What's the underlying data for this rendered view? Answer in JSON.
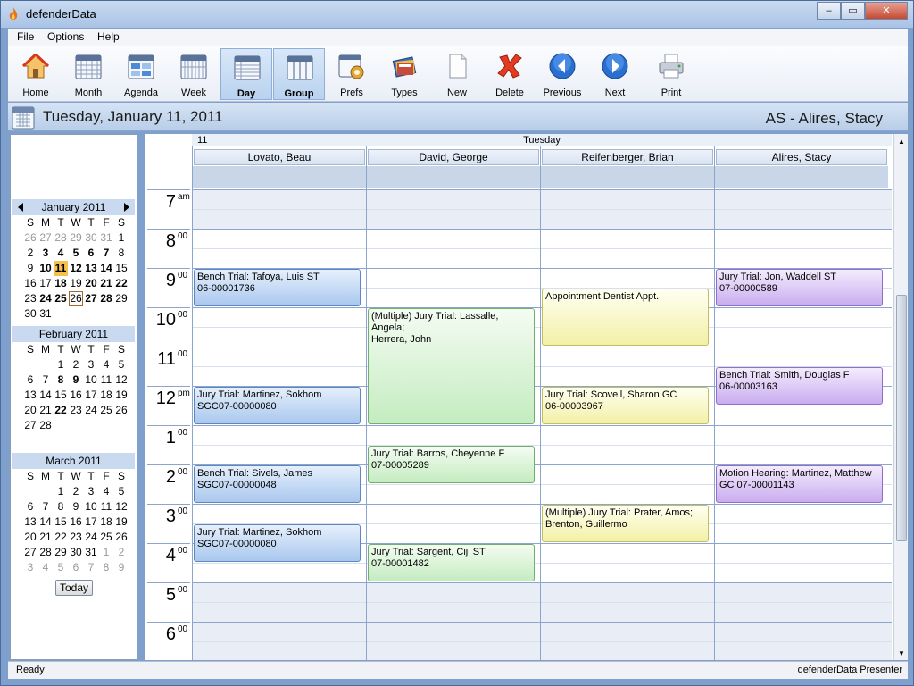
{
  "window": {
    "title": "defenderData",
    "min": "–",
    "max": "▭",
    "close": "✕"
  },
  "menu": [
    {
      "label": "File"
    },
    {
      "label": "Options"
    },
    {
      "label": "Help"
    }
  ],
  "toolbar": [
    {
      "label": "Home",
      "icon": "home-icon"
    },
    {
      "label": "Month",
      "icon": "month-calendar-icon"
    },
    {
      "label": "Agenda",
      "icon": "agenda-icon"
    },
    {
      "label": "Week",
      "icon": "week-calendar-icon"
    },
    {
      "label": "Day",
      "icon": "day-calendar-icon",
      "active": true
    },
    {
      "label": "Group",
      "icon": "group-calendar-icon",
      "active": true
    },
    {
      "label": "Prefs",
      "icon": "prefs-gear-icon"
    },
    {
      "label": "Types",
      "icon": "types-book-icon"
    },
    {
      "label": "New",
      "icon": "new-document-icon"
    },
    {
      "label": "Delete",
      "icon": "delete-x-icon"
    },
    {
      "label": "Previous",
      "icon": "previous-arrow-icon"
    },
    {
      "label": "Next",
      "icon": "next-arrow-icon"
    },
    {
      "label": "Print",
      "icon": "printer-icon"
    }
  ],
  "header": {
    "date": "Tuesday, January 11, 2011",
    "user": "AS - Alires, Stacy"
  },
  "minical": {
    "dow": [
      "S",
      "M",
      "T",
      "W",
      "T",
      "F",
      "S"
    ],
    "months": [
      {
        "title": "January 2011",
        "weeks": [
          [
            "26",
            "27",
            "28",
            "29",
            "30",
            "31",
            "1"
          ],
          [
            "2",
            "3",
            "4",
            "5",
            "6",
            "7",
            "8"
          ],
          [
            "9",
            "10",
            "11",
            "12",
            "13",
            "14",
            "15"
          ],
          [
            "16",
            "17",
            "18",
            "19",
            "20",
            "21",
            "22"
          ],
          [
            "23",
            "24",
            "25",
            "26",
            "27",
            "28",
            "29"
          ],
          [
            "30",
            "31",
            "",
            "",
            "",
            "",
            ""
          ]
        ]
      },
      {
        "title": "February 2011",
        "weeks": [
          [
            "",
            "",
            "1",
            "2",
            "3",
            "4",
            "5"
          ],
          [
            "6",
            "7",
            "8",
            "9",
            "10",
            "11",
            "12"
          ],
          [
            "13",
            "14",
            "15",
            "16",
            "17",
            "18",
            "19"
          ],
          [
            "20",
            "21",
            "22",
            "23",
            "24",
            "25",
            "26"
          ],
          [
            "27",
            "28",
            "",
            "",
            "",
            "",
            ""
          ]
        ]
      },
      {
        "title": "March 2011",
        "weeks": [
          [
            "",
            "",
            "1",
            "2",
            "3",
            "4",
            "5"
          ],
          [
            "6",
            "7",
            "8",
            "9",
            "10",
            "11",
            "12"
          ],
          [
            "13",
            "14",
            "15",
            "16",
            "17",
            "18",
            "19"
          ],
          [
            "20",
            "21",
            "22",
            "23",
            "24",
            "25",
            "26"
          ],
          [
            "27",
            "28",
            "29",
            "30",
            "31",
            "1",
            "2"
          ],
          [
            "3",
            "4",
            "5",
            "6",
            "7",
            "8",
            "9"
          ]
        ]
      }
    ],
    "today_label": "Today"
  },
  "grid": {
    "day_number": "11",
    "day_name": "Tuesday",
    "columns": [
      "Lovato, Beau",
      "David, George",
      "Reifenberger, Brian",
      "Alires, Stacy"
    ],
    "hours": [
      {
        "h": "7",
        "m": "am"
      },
      {
        "h": "8",
        "m": "00"
      },
      {
        "h": "9",
        "m": "00"
      },
      {
        "h": "10",
        "m": "00"
      },
      {
        "h": "11",
        "m": "00"
      },
      {
        "h": "12",
        "m": "pm"
      },
      {
        "h": "1",
        "m": "00"
      },
      {
        "h": "2",
        "m": "00"
      },
      {
        "h": "3",
        "m": "00"
      },
      {
        "h": "4",
        "m": "00"
      },
      {
        "h": "5",
        "m": "00"
      },
      {
        "h": "6",
        "m": "00"
      }
    ],
    "appointments": [
      {
        "col": 0,
        "start": "9:00",
        "end": "10:00",
        "color": "blue",
        "line1": "Bench Trial: Tafoya, Luis ST",
        "line2": "06-00001736"
      },
      {
        "col": 0,
        "start": "12:00",
        "end": "1:00",
        "color": "blue",
        "line1": "Jury Trial: Martinez, Sokhom",
        "line2": "SGC07-00000080"
      },
      {
        "col": 0,
        "start": "2:00",
        "end": "3:00",
        "color": "blue",
        "line1": "Bench Trial: Sivels, James",
        "line2": "SGC07-00000048"
      },
      {
        "col": 0,
        "start": "3:30",
        "end": "4:30",
        "color": "blue",
        "line1": "Jury Trial: Martinez, Sokhom",
        "line2": "SGC07-00000080"
      },
      {
        "col": 1,
        "start": "10:00",
        "end": "1:00",
        "color": "green",
        "line1": "(Multiple) Jury Trial: Lassalle, Angela;",
        "line2": "Herrera, John"
      },
      {
        "col": 1,
        "start": "1:30",
        "end": "2:30",
        "color": "green",
        "line1": "Jury Trial: Barros, Cheyenne F",
        "line2": "07-00005289"
      },
      {
        "col": 1,
        "start": "4:00",
        "end": "5:00",
        "color": "green",
        "line1": "Jury Trial: Sargent, Ciji ST",
        "line2": "07-00001482"
      },
      {
        "col": 2,
        "start": "9:30",
        "end": "11:00",
        "color": "yellow",
        "line1": "Appointment Dentist Appt.",
        "line2": ""
      },
      {
        "col": 2,
        "start": "12:00",
        "end": "1:00",
        "color": "yellow",
        "line1": "Jury Trial: Scovell, Sharon GC",
        "line2": "06-00003967"
      },
      {
        "col": 2,
        "start": "3:00",
        "end": "4:00",
        "color": "yellow",
        "line1": "(Multiple) Jury Trial: Prater, Amos;",
        "line2": "Brenton, Guillermo"
      },
      {
        "col": 3,
        "start": "9:00",
        "end": "10:00",
        "color": "purple",
        "line1": "Jury Trial: Jon, Waddell ST",
        "line2": "07-00000589"
      },
      {
        "col": 3,
        "start": "11:30",
        "end": "12:30",
        "color": "purple",
        "line1": "Bench Trial: Smith, Douglas F",
        "line2": "06-00003163"
      },
      {
        "col": 3,
        "start": "2:00",
        "end": "3:00",
        "color": "purple",
        "line1": "Motion Hearing: Martinez, Matthew",
        "line2": "GC 07-00001143"
      }
    ]
  },
  "status": {
    "left": "Ready",
    "right": "defenderData Presenter"
  }
}
